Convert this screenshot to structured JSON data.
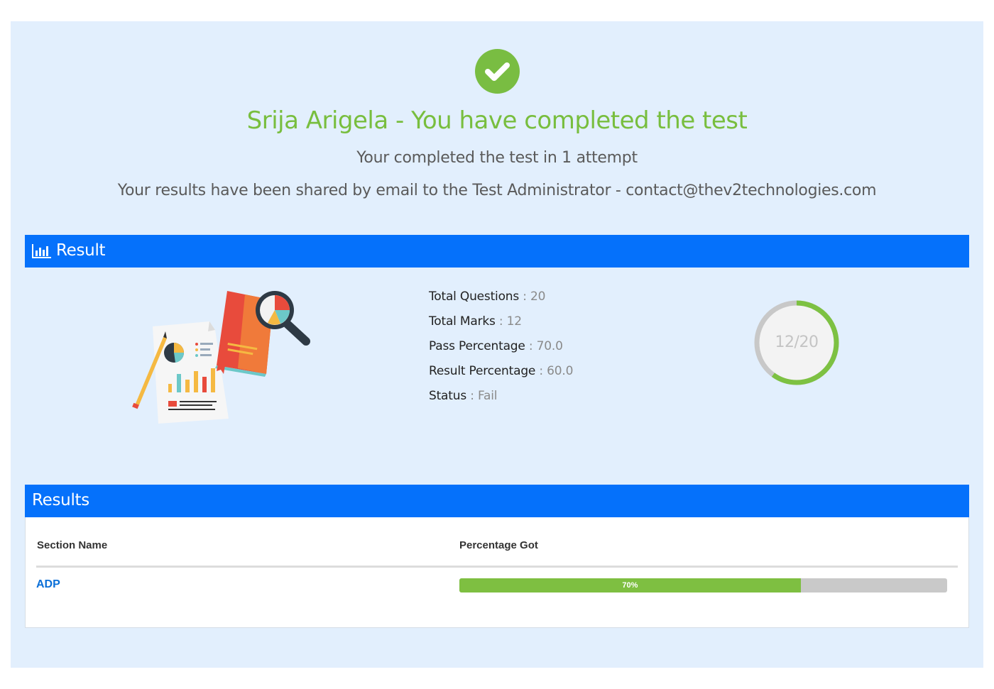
{
  "header": {
    "title": "Srija Arigela - You have completed the test",
    "attempts_text": "Your completed the test in 1 attempt",
    "shared_text": "Your results have been shared by email to the Test Administrator - contact@thev2technologies.com"
  },
  "result_section": {
    "heading": "Result",
    "icon": "bar-chart-icon",
    "stats": [
      {
        "label": "Total Questions",
        "sep": ":",
        "value": "20"
      },
      {
        "label": "Total Marks",
        "sep": ":",
        "value": "12"
      },
      {
        "label": "Pass Percentage",
        "sep": ":",
        "value": "70.0"
      },
      {
        "label": "Result Percentage",
        "sep": ":",
        "value": "60.0"
      },
      {
        "label": "Status",
        "sep": ":",
        "value": "Fail"
      }
    ],
    "score": {
      "text": "12/20",
      "correct": 12,
      "total": 20,
      "ring_color": "#7dc142",
      "track_color": "#c8c8c8"
    }
  },
  "results_table": {
    "heading": "Results",
    "columns": [
      "Section Name",
      "Percentage Got"
    ],
    "rows": [
      {
        "section": "ADP",
        "percentage_label": "70%",
        "percentage": 70
      }
    ]
  },
  "colors": {
    "accent_blue": "#0571fb",
    "success_green": "#79bd42",
    "panel_bg": "#e2effd"
  }
}
